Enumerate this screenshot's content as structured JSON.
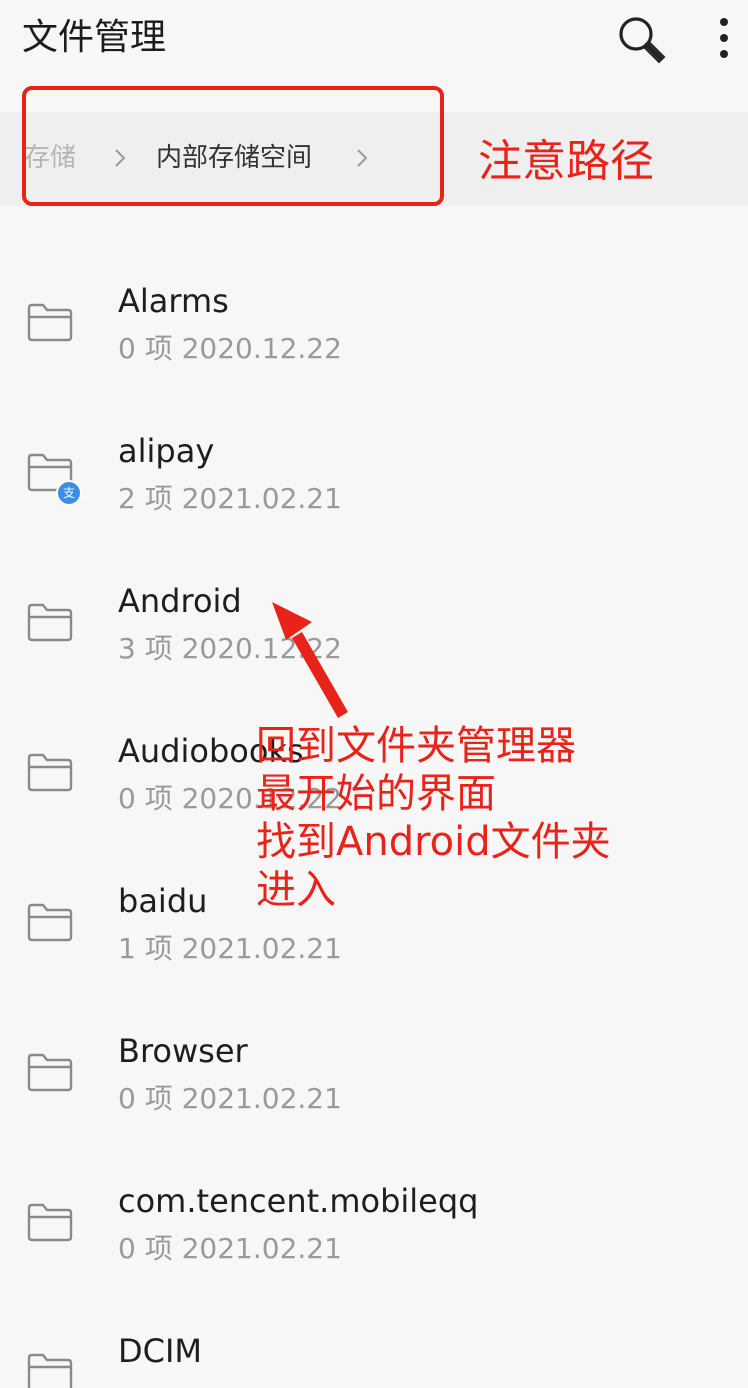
{
  "header": {
    "title": "文件管理",
    "search_icon": "search-icon",
    "more_icon": "more-vertical-icon"
  },
  "breadcrumb": {
    "items": [
      "存储",
      "内部存储空间"
    ],
    "separator_icon": "chevron-right-icon"
  },
  "annotations": {
    "path_note": "注意路径",
    "instruction": "回到文件夹管理器\n最开始的界面\n找到Android文件夹\n进入",
    "color": "#e8231a"
  },
  "files": [
    {
      "name": "Alarms",
      "meta": "0 项  2020.12.22",
      "badge": ""
    },
    {
      "name": "alipay",
      "meta": "2 项  2021.02.21",
      "badge": "支"
    },
    {
      "name": "Android",
      "meta": "3 项  2020.12.22",
      "badge": ""
    },
    {
      "name": "Audiobooks",
      "meta": "0 项  2020.12.22",
      "badge": ""
    },
    {
      "name": "baidu",
      "meta": "1 项  2021.02.21",
      "badge": ""
    },
    {
      "name": "Browser",
      "meta": "0 项  2021.02.21",
      "badge": ""
    },
    {
      "name": "com.tencent.mobileqq",
      "meta": "0 项  2021.02.21",
      "badge": ""
    },
    {
      "name": "DCIM",
      "meta": "",
      "badge": ""
    }
  ]
}
